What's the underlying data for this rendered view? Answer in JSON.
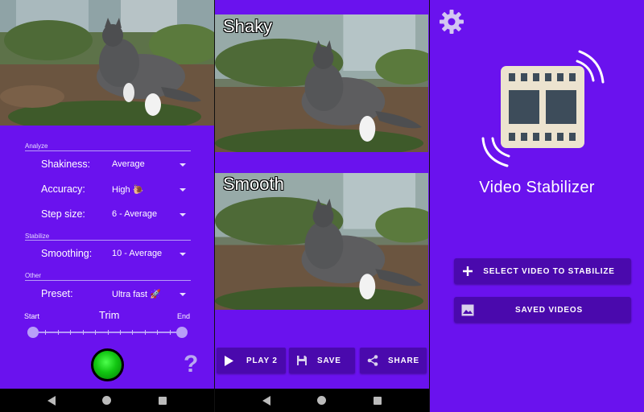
{
  "settings": {
    "analyze_section": "Analyze",
    "shakiness": {
      "label": "Shakiness:",
      "value": "Average"
    },
    "accuracy": {
      "label": "Accuracy:",
      "value": "High 🐌"
    },
    "step_size": {
      "label": "Step size:",
      "value": "6 - Average"
    },
    "stabilize_section": "Stabilize",
    "smoothing": {
      "label": "Smoothing:",
      "value": "10 - Average"
    },
    "other_section": "Other",
    "preset": {
      "label": "Preset:",
      "value": "Ultra fast 🚀"
    },
    "trim": {
      "start_label": "Start",
      "title": "Trim",
      "end_label": "End",
      "start_fraction": 0,
      "end_fraction": 1
    },
    "help_symbol": "?"
  },
  "preview": {
    "shaky_label": "Shaky",
    "smooth_label": "Smooth",
    "play_label": "PLAY 2",
    "save_label": "SAVE",
    "share_label": "SHARE"
  },
  "home": {
    "app_title": "Video Stabilizer",
    "select_video_label": "SELECT VIDEO TO STABILIZE",
    "saved_videos_label": "SAVED VIDEOS"
  },
  "icons": {
    "settings": "gear-icon",
    "play": "play-icon",
    "save": "floppy-icon",
    "share": "share-icon",
    "add": "plus-icon",
    "gallery": "image-icon",
    "logo": "film-strip-icon"
  },
  "colors": {
    "background": "#6a12ee",
    "button": "#4a09ad",
    "go_button": "#12c612"
  }
}
